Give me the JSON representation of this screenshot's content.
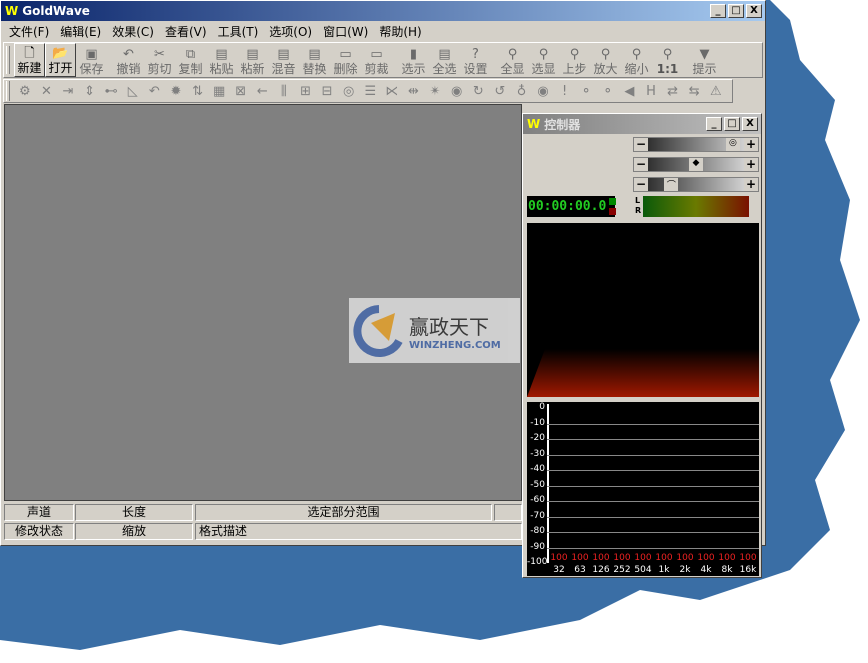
{
  "window": {
    "title": "GoldWave",
    "logo": "W",
    "min": "_",
    "max": "□",
    "close": "X"
  },
  "menu": [
    "文件(F)",
    "编辑(E)",
    "效果(C)",
    "查看(V)",
    "工具(T)",
    "选项(O)",
    "窗口(W)",
    "帮助(H)"
  ],
  "toolbar": [
    {
      "label": "新建",
      "icon": "new-file",
      "active": true
    },
    {
      "label": "打开",
      "icon": "open-folder",
      "active": true
    },
    {
      "label": "保存",
      "icon": "save"
    },
    {
      "label": "撤销",
      "icon": "undo"
    },
    {
      "label": "剪切",
      "icon": "cut"
    },
    {
      "label": "复制",
      "icon": "copy"
    },
    {
      "label": "粘贴",
      "icon": "paste"
    },
    {
      "label": "粘新",
      "icon": "paste-new"
    },
    {
      "label": "混音",
      "icon": "mix"
    },
    {
      "label": "替换",
      "icon": "replace"
    },
    {
      "label": "删除",
      "icon": "delete"
    },
    {
      "label": "剪裁",
      "icon": "trim"
    },
    {
      "label": "选示",
      "icon": "select-view"
    },
    {
      "label": "全选",
      "icon": "select-all"
    },
    {
      "label": "设置",
      "icon": "settings"
    },
    {
      "label": "全显",
      "icon": "zoom-all"
    },
    {
      "label": "选显",
      "icon": "zoom-selection"
    },
    {
      "label": "上步",
      "icon": "zoom-previous"
    },
    {
      "label": "放大",
      "icon": "zoom-in"
    },
    {
      "label": "缩小",
      "icon": "zoom-out"
    },
    {
      "label": "1:1",
      "icon": "zoom-1to1"
    },
    {
      "label": "提示",
      "icon": "hint-dropdown"
    }
  ],
  "effects_toolbar_count": 33,
  "status": {
    "row1": [
      "声道",
      "长度",
      "选定部分范围",
      ""
    ],
    "row2": [
      "修改状态",
      "缩放",
      "格式描述"
    ]
  },
  "controller": {
    "title": "控制器",
    "logo": "W",
    "time": "00:00:00.0",
    "meter_labels": [
      "L",
      "R"
    ],
    "sliders": [
      {
        "name": "volume",
        "value": 0.95
      },
      {
        "name": "balance",
        "value": 0.5
      },
      {
        "name": "speed",
        "value": 0.2
      }
    ],
    "eq": {
      "y_ticks": [
        "0",
        "-10",
        "-20",
        "-30",
        "-40",
        "-50",
        "-60",
        "-70",
        "-80",
        "-90",
        "-100"
      ],
      "bands": [
        "32",
        "63",
        "126",
        "252",
        "504",
        "1k",
        "2k",
        "4k",
        "8k",
        "16k"
      ],
      "values": [
        "100",
        "100",
        "100",
        "100",
        "100",
        "100",
        "100",
        "100",
        "100",
        "100"
      ]
    }
  },
  "watermark": {
    "name": "赢政天下",
    "url": "WINZHENG.COM"
  },
  "colors": {
    "title_active": "#0a246a",
    "desktop": "#3a6ea5",
    "time_green": "#22cc22"
  }
}
